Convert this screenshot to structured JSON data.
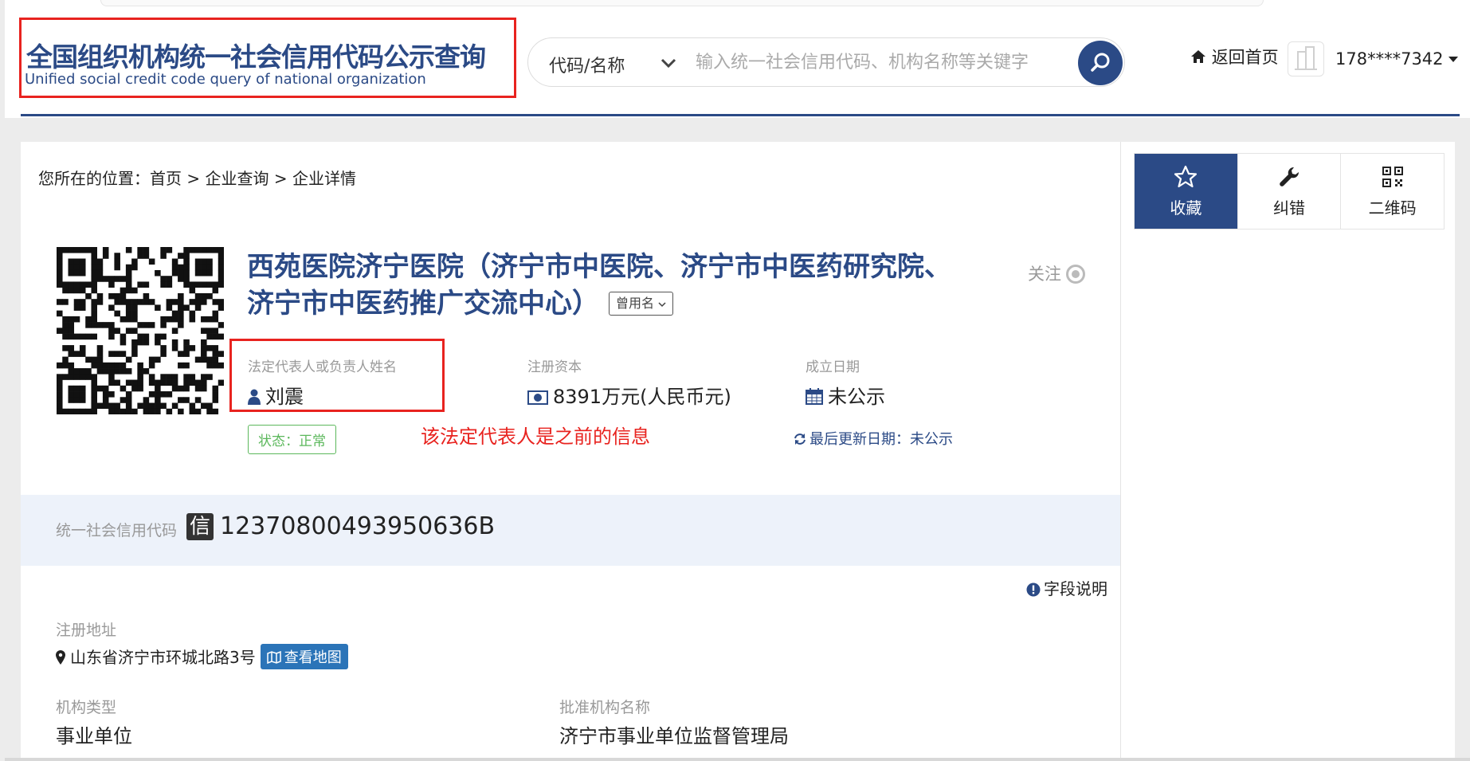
{
  "header": {
    "logo_cn": "全国组织机构统一社会信用代码公示查询",
    "logo_en": "Unified social credit code query of national organization",
    "search_type": "代码/名称",
    "search_placeholder": "输入统一社会信用代码、机构名称等关键字",
    "home_label": "返回首页",
    "user_phone": "178****7342"
  },
  "breadcrumb": "您所在的位置：首页 > 企业查询 > 企业详情",
  "org": {
    "title": "西苑医院济宁医院（济宁市中医院、济宁市中医药研究院、济宁市中医药推广交流中心）",
    "former_name_label": "曾用名",
    "follow_label": "关注",
    "legal_rep_label": "法定代表人或负责人姓名",
    "legal_rep_value": "刘震",
    "capital_label": "注册资本",
    "capital_value": "8391万元(人民币元)",
    "founded_label": "成立日期",
    "founded_value": "未公示",
    "status": "状态：正常",
    "annotation_note": "该法定代表人是之前的信息",
    "last_updated": "最后更新日期：未公示",
    "credit_code_label": "统一社会信用代码",
    "credit_badge": "信",
    "credit_code": "12370800493950636B",
    "field_desc_label": "字段说明",
    "address_label": "注册地址",
    "address_value": "山东省济宁市环城北路3号",
    "map_button": "查看地图",
    "org_type_label": "机构类型",
    "org_type_value": "事业单位",
    "approval_label": "批准机构名称",
    "approval_value": "济宁市事业单位监督管理局"
  },
  "actions": [
    {
      "label": "收藏",
      "icon": "star-icon"
    },
    {
      "label": "纠错",
      "icon": "wrench-icon"
    },
    {
      "label": "二维码",
      "icon": "qrcode-icon"
    }
  ],
  "colors": {
    "brand": "#2b4a86",
    "annotation_red": "#e8231f",
    "status_green": "#5cb85c",
    "map_button": "#2b74b8"
  }
}
